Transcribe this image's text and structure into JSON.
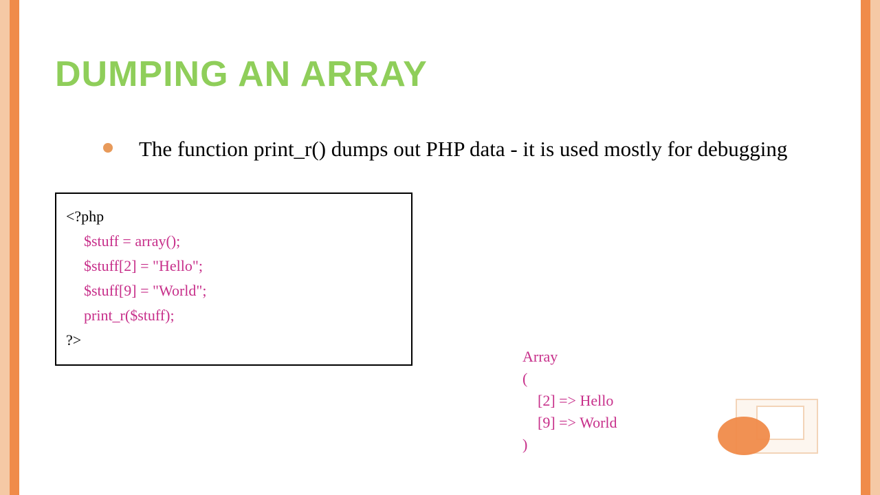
{
  "slide": {
    "title": "DUMPING AN ARRAY",
    "bullet": "The function print_r() dumps out PHP data - it is used mostly for debugging",
    "code": {
      "open": "<?php",
      "l1": "$stuff = array();",
      "l2": "$stuff[2] = \"Hello\";",
      "l3": "$stuff[9] = \"World\";",
      "l4": "print_r($stuff);",
      "close": "?>"
    },
    "output": {
      "o1": "Array",
      "o2": "(",
      "o3": "[2] => Hello",
      "o4": "[9] => World",
      "o5": ")"
    }
  }
}
